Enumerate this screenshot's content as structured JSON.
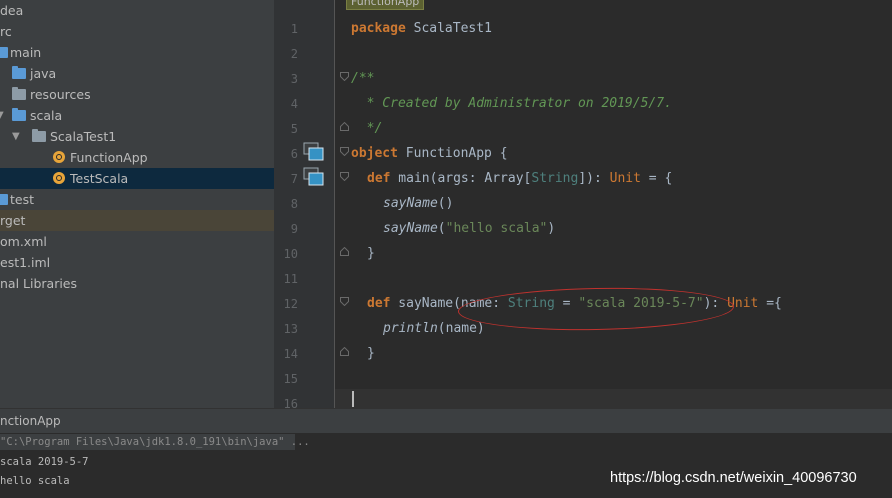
{
  "project_tree": {
    "items": [
      {
        "label": "dea"
      },
      {
        "label": "rc"
      },
      {
        "label": "main"
      },
      {
        "label": "java"
      },
      {
        "label": "resources"
      },
      {
        "label": "scala"
      },
      {
        "label": "ScalaTest1"
      },
      {
        "label": "FunctionApp"
      },
      {
        "label": "TestScala"
      },
      {
        "label": "test"
      },
      {
        "label": "rget"
      },
      {
        "label": "om.xml"
      },
      {
        "label": "est1.iml"
      },
      {
        "label": "nal Libraries"
      }
    ]
  },
  "editor": {
    "breadcrumb": "FunctionApp",
    "line_numbers": [
      "1",
      "2",
      "3",
      "4",
      "5",
      "6",
      "7",
      "8",
      "9",
      "10",
      "11",
      "12",
      "13",
      "14",
      "15",
      "16"
    ],
    "l1": {
      "kw": "package",
      "rest": " ScalaTest1"
    },
    "l3": "/**",
    "l4": "  * Created by Administrator on 2019/5/7.",
    "l5": "  */",
    "l6": {
      "kw": "object",
      "rest": " FunctionApp {"
    },
    "l7": {
      "kw": "def",
      "name": " main(args: Array[",
      "type": "String",
      "mid": "]): ",
      "ret": "Unit",
      "end": " = {"
    },
    "l8": "sayName",
    "l8b": "()",
    "l9": {
      "fn": "sayName",
      "open": "(",
      "str": "\"hello scala\"",
      "close": ")"
    },
    "l10": "}",
    "l12": {
      "kw": "def",
      "name": " sayName(name: ",
      "type": "String",
      "eq": " = ",
      "str": "\"scala 2019-5-7\"",
      "close": "): ",
      "ret": "Unit",
      "end": " ={"
    },
    "l13": {
      "fn": "println",
      "args": "(name)"
    },
    "l14": "}"
  },
  "run_panel": {
    "title": "nctionApp",
    "command": "\"C:\\Program Files\\Java\\jdk1.8.0_191\\bin\\java\" ...",
    "output": [
      "scala 2019-5-7",
      "hello scala"
    ]
  },
  "watermark": "https://blog.csdn.net/weixin_40096730",
  "colors": {
    "keyword": "#cc7832",
    "doc_comment": "#629755",
    "string": "#6a8759",
    "type": "#4e807d",
    "annotation_ellipse": "#c0322e"
  }
}
